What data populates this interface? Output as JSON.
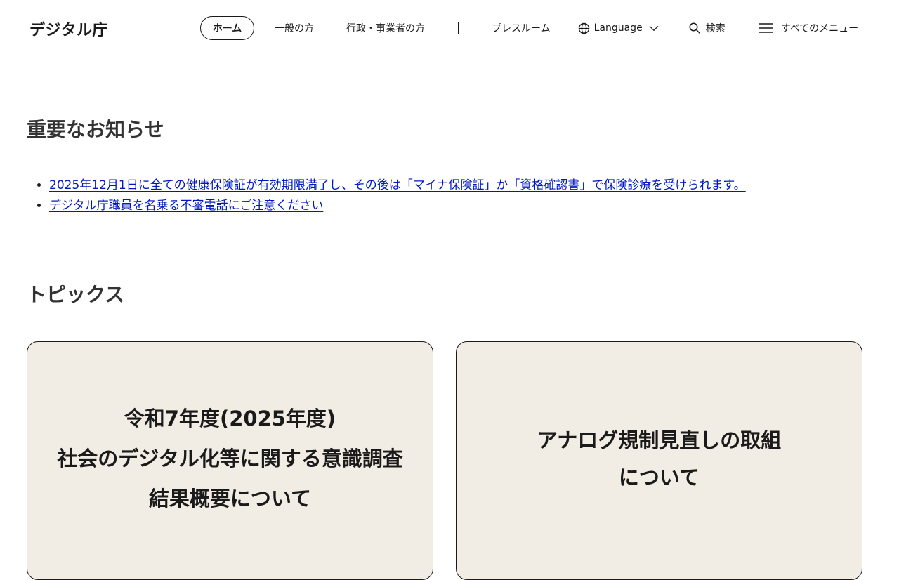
{
  "header": {
    "logo": "デジタル庁",
    "nav": {
      "home": "ホーム",
      "general": "一般の方",
      "gov": "行政・事業者の方",
      "press": "プレスルーム",
      "language": "Language",
      "search": "検索",
      "menu": "すべてのメニュー"
    }
  },
  "notices": {
    "title": "重要なお知らせ",
    "items": [
      "2025年12月1日に全ての健康保険証が有効期限満了し、その後は「マイナ保険証」か「資格確認書」で保険診療を受けられます。",
      "デジタル庁職員を名乗る不審電話にご注意ください"
    ]
  },
  "topics": {
    "title": "トピックス",
    "cards": [
      "令和7年度(2025年度)\n社会のデジタル化等に関する意識調査\n結果概要について",
      "アナログ規制見直しの取組\nについて"
    ]
  },
  "colors": {
    "link": "#0017c1",
    "card_bg": "#f1ece4",
    "text": "#1a1a1a"
  },
  "icons": {
    "language": "globe-icon",
    "language_toggle": "chevron-down-icon",
    "search": "search-icon",
    "menu": "hamburger-menu-icon"
  }
}
